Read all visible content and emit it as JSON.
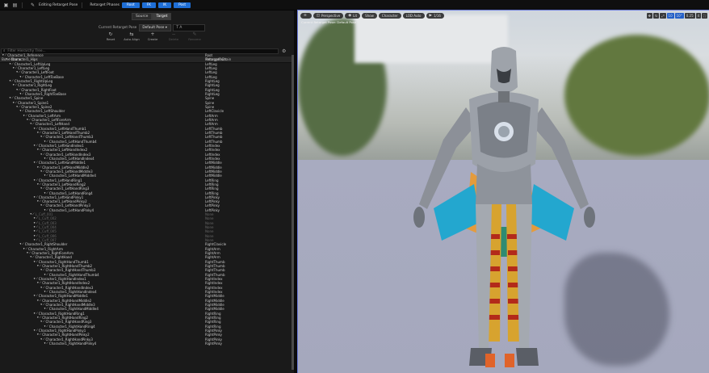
{
  "topbar": {
    "title": "Editing Retarget Pose",
    "phases_label": "Retarget Phases",
    "buttons": [
      "Root",
      "FK",
      "IK",
      "Post"
    ]
  },
  "mode_tabs": [
    "Source",
    "Target"
  ],
  "pose": {
    "label": "Current Retarget Pose",
    "selected": "Default Pose",
    "field_value": "T A"
  },
  "tools": [
    {
      "icon": "reset-icon",
      "glyph": "↻",
      "label": "Reset",
      "enabled": true
    },
    {
      "icon": "auto-align-icon",
      "glyph": "⇆",
      "label": "Auto Align",
      "enabled": true
    },
    {
      "icon": "create-icon",
      "glyph": "+",
      "label": "Create",
      "enabled": true
    },
    {
      "icon": "delete-icon",
      "glyph": "−",
      "label": "Delete",
      "enabled": false
    },
    {
      "icon": "rename-icon",
      "glyph": "✎",
      "label": "Rename",
      "enabled": false
    }
  ],
  "search": {
    "placeholder": "Filter Hierarchy Tree..."
  },
  "table": {
    "columns": [
      "Bone Name",
      "Retarget Chain"
    ],
    "rows": [
      {
        "name": "Character1_Reference",
        "chain": "Root",
        "d": 0
      },
      {
        "name": "Character1_Hips",
        "chain": "RetargetRoot",
        "d": 1
      },
      {
        "name": "Character1_LeftUpLeg",
        "chain": "LeftLeg",
        "d": 2
      },
      {
        "name": "Character1_LeftLeg",
        "chain": "LeftLeg",
        "d": 3
      },
      {
        "name": "Character1_LeftFoot",
        "chain": "LeftLeg",
        "d": 4
      },
      {
        "name": "Character1_LeftToeBase",
        "chain": "LeftLeg",
        "d": 5
      },
      {
        "name": "Character1_RightUpLeg",
        "chain": "RightLeg",
        "d": 2
      },
      {
        "name": "Character1_RightLeg",
        "chain": "RightLeg",
        "d": 3
      },
      {
        "name": "Character1_RightFoot",
        "chain": "RightLeg",
        "d": 4
      },
      {
        "name": "Character1_RightToeBase",
        "chain": "RightLeg",
        "d": 5
      },
      {
        "name": "Character1_Spine",
        "chain": "Spine",
        "d": 2
      },
      {
        "name": "Character1_Spine1",
        "chain": "Spine",
        "d": 3
      },
      {
        "name": "Character1_Spine2",
        "chain": "Spine",
        "d": 4
      },
      {
        "name": "Character1_LeftShoulder",
        "chain": "LeftClavicle",
        "d": 5
      },
      {
        "name": "Character1_LeftArm",
        "chain": "LeftArm",
        "d": 6
      },
      {
        "name": "Character1_LeftForeArm",
        "chain": "LeftArm",
        "d": 7
      },
      {
        "name": "Character1_LeftHand",
        "chain": "LeftArm",
        "d": 8
      },
      {
        "name": "Character1_LeftHandThumb1",
        "chain": "LeftThumb",
        "d": 9
      },
      {
        "name": "Character1_LeftHandThumb2",
        "chain": "LeftThumb",
        "d": 10
      },
      {
        "name": "Character1_LeftHandThumb3",
        "chain": "LeftThumb",
        "d": 11
      },
      {
        "name": "Character1_LeftHandThumb4",
        "chain": "LeftThumb",
        "d": 12
      },
      {
        "name": "Character1_LeftHandIndex1",
        "chain": "LeftIndex",
        "d": 9
      },
      {
        "name": "Character1_LeftHandIndex2",
        "chain": "LeftIndex",
        "d": 10
      },
      {
        "name": "Character1_LeftHandIndex3",
        "chain": "LeftIndex",
        "d": 11
      },
      {
        "name": "Character1_LeftHandIndex4",
        "chain": "LeftIndex",
        "d": 12
      },
      {
        "name": "Character1_LeftHandMiddle1",
        "chain": "LeftMiddle",
        "d": 9
      },
      {
        "name": "Character1_LeftHandMiddle2",
        "chain": "LeftMiddle",
        "d": 10
      },
      {
        "name": "Character1_LeftHandMiddle3",
        "chain": "LeftMiddle",
        "d": 11
      },
      {
        "name": "Character1_LeftHandMiddle4",
        "chain": "LeftMiddle",
        "d": 12
      },
      {
        "name": "Character1_LeftHandRing1",
        "chain": "LeftRing",
        "d": 9
      },
      {
        "name": "Character1_LeftHandRing2",
        "chain": "LeftRing",
        "d": 10
      },
      {
        "name": "Character1_LeftHandRing3",
        "chain": "LeftRing",
        "d": 11
      },
      {
        "name": "Character1_LeftHandRing4",
        "chain": "LeftRing",
        "d": 12
      },
      {
        "name": "Character1_LeftHandPinky1",
        "chain": "LeftPinky",
        "d": 9
      },
      {
        "name": "Character1_LeftHandPinky2",
        "chain": "LeftPinky",
        "d": 10
      },
      {
        "name": "Character1_LeftHandPinky3",
        "chain": "LeftPinky",
        "d": 11
      },
      {
        "name": "Character1_LeftHandPinky4",
        "chain": "LeftPinky",
        "d": 12
      },
      {
        "name": "L_Cuff_001",
        "chain": "None",
        "d": 8,
        "dim": true
      },
      {
        "name": "L_Cuff_002",
        "chain": "None",
        "d": 9,
        "dim": true
      },
      {
        "name": "L_Cuff_003",
        "chain": "None",
        "d": 9,
        "dim": true
      },
      {
        "name": "L_Cuff_004",
        "chain": "None",
        "d": 9,
        "dim": true
      },
      {
        "name": "L_Cuff_005",
        "chain": "None",
        "d": 9,
        "dim": true
      },
      {
        "name": "L_Cuff_006",
        "chain": "None",
        "d": 9,
        "dim": true
      },
      {
        "name": "L_Cuff_007",
        "chain": "None",
        "d": 9,
        "dim": true
      },
      {
        "name": "Character1_RightShoulder",
        "chain": "RightClavicle",
        "d": 5
      },
      {
        "name": "Character1_RightArm",
        "chain": "RightArm",
        "d": 6
      },
      {
        "name": "Character1_RightForeArm",
        "chain": "RightArm",
        "d": 7
      },
      {
        "name": "Character1_RightHand",
        "chain": "RightArm",
        "d": 8
      },
      {
        "name": "Character1_RightHandThumb1",
        "chain": "RightThumb",
        "d": 9
      },
      {
        "name": "Character1_RightHandThumb2",
        "chain": "RightThumb",
        "d": 10
      },
      {
        "name": "Character1_RightHandThumb3",
        "chain": "RightThumb",
        "d": 11
      },
      {
        "name": "Character1_RightHandThumb4",
        "chain": "RightThumb",
        "d": 12
      },
      {
        "name": "Character1_RightHandIndex1",
        "chain": "RightIndex",
        "d": 9
      },
      {
        "name": "Character1_RightHandIndex2",
        "chain": "RightIndex",
        "d": 10
      },
      {
        "name": "Character1_RightHandIndex3",
        "chain": "RightIndex",
        "d": 11
      },
      {
        "name": "Character1_RightHandIndex4",
        "chain": "RightIndex",
        "d": 12
      },
      {
        "name": "Character1_RightHandMiddle1",
        "chain": "RightMiddle",
        "d": 9
      },
      {
        "name": "Character1_RightHandMiddle2",
        "chain": "RightMiddle",
        "d": 10
      },
      {
        "name": "Character1_RightHandMiddle3",
        "chain": "RightMiddle",
        "d": 11
      },
      {
        "name": "Character1_RightHandMiddle4",
        "chain": "RightMiddle",
        "d": 12
      },
      {
        "name": "Character1_RightHandRing1",
        "chain": "RightRing",
        "d": 9
      },
      {
        "name": "Character1_RightHandRing2",
        "chain": "RightRing",
        "d": 10
      },
      {
        "name": "Character1_RightHandRing3",
        "chain": "RightRing",
        "d": 11
      },
      {
        "name": "Character1_RightHandRing4",
        "chain": "RightRing",
        "d": 12
      },
      {
        "name": "Character1_RightHandPinky1",
        "chain": "RightPinky",
        "d": 9
      },
      {
        "name": "Character1_RightHandPinky2",
        "chain": "RightPinky",
        "d": 10
      },
      {
        "name": "Character1_RightHandPinky3",
        "chain": "RightPinky",
        "d": 11
      },
      {
        "name": "Character1_RightHandPinky4",
        "chain": "RightPinky",
        "d": 12
      }
    ]
  },
  "viewport": {
    "view_mode": "Perspective",
    "lit": "Lit",
    "show": "Show",
    "character": "Character",
    "lod": "LOD Auto",
    "speed": "1/16",
    "info": "Current Retarget Pose: Default Pose",
    "right_buttons": [
      "10",
      "10°",
      "0.25",
      "4"
    ]
  },
  "colors": {
    "accent": "#1f6fd6",
    "viewport_outline": "#6a7ad8"
  }
}
